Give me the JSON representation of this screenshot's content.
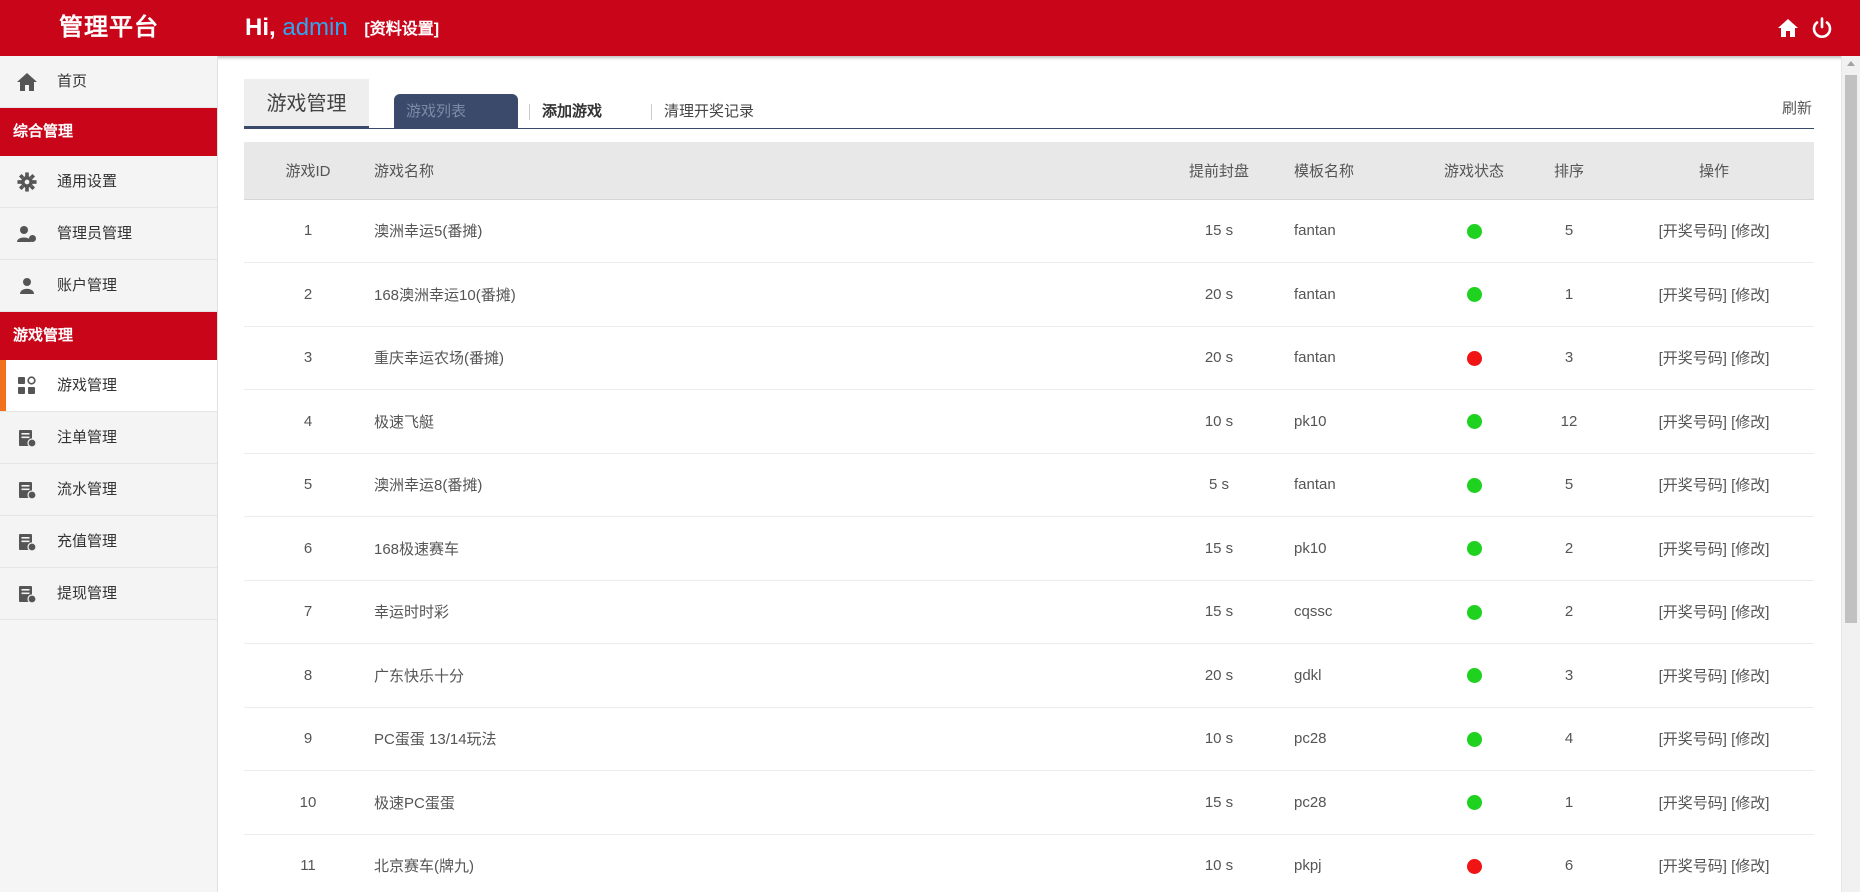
{
  "header": {
    "logo": "管理平台",
    "greeting": "Hi,",
    "username": "admin",
    "profile_link": "[资料设置]",
    "home_icon": "home-icon",
    "power_icon": "power-icon",
    "bg_color": "#c90519"
  },
  "sidebar": {
    "home": {
      "label": "首页",
      "icon": "home-icon"
    },
    "group1": {
      "title": "综合管理"
    },
    "general": {
      "label": "通用设置",
      "icon": "gear-icon"
    },
    "admins": {
      "label": "管理员管理",
      "icon": "admins-icon"
    },
    "accounts": {
      "label": "账户管理",
      "icon": "user-icon"
    },
    "group2": {
      "title": "游戏管理"
    },
    "games": {
      "label": "游戏管理",
      "icon": "apps-icon"
    },
    "bets": {
      "label": "注单管理",
      "icon": "ledger-icon"
    },
    "flows": {
      "label": "流水管理",
      "icon": "ledger-icon"
    },
    "recharge": {
      "label": "充值管理",
      "icon": "ledger-icon"
    },
    "withdraw": {
      "label": "提现管理",
      "icon": "ledger-icon"
    },
    "active_accent": "#f2711c"
  },
  "main": {
    "page_title": "游戏管理",
    "tabs": {
      "list": "游戏列表",
      "add": "添加游戏",
      "clear": "清理开奖记录"
    },
    "refresh": "刷新",
    "columns": {
      "id": "游戏ID",
      "name": "游戏名称",
      "close": "提前封盘",
      "template": "模板名称",
      "status": "游戏状态",
      "sort": "排序",
      "op": "操作"
    },
    "ops": {
      "draw": "[开奖号码]",
      "edit": "[修改]"
    },
    "status_colors": {
      "on": "#1fd21f",
      "off": "#f01414"
    },
    "rows": [
      {
        "id": "1",
        "name": "澳洲幸运5(番摊)",
        "close": "15 s",
        "template": "fantan",
        "status": "on",
        "sort": "5"
      },
      {
        "id": "2",
        "name": "168澳洲幸运10(番摊)",
        "close": "20 s",
        "template": "fantan",
        "status": "on",
        "sort": "1"
      },
      {
        "id": "3",
        "name": "重庆幸运农场(番摊)",
        "close": "20 s",
        "template": "fantan",
        "status": "off",
        "sort": "3"
      },
      {
        "id": "4",
        "name": "极速飞艇",
        "close": "10 s",
        "template": "pk10",
        "status": "on",
        "sort": "12"
      },
      {
        "id": "5",
        "name": "澳洲幸运8(番摊)",
        "close": "5 s",
        "template": "fantan",
        "status": "on",
        "sort": "5"
      },
      {
        "id": "6",
        "name": "168极速赛车",
        "close": "15 s",
        "template": "pk10",
        "status": "on",
        "sort": "2"
      },
      {
        "id": "7",
        "name": "幸运时时彩",
        "close": "15 s",
        "template": "cqssc",
        "status": "on",
        "sort": "2"
      },
      {
        "id": "8",
        "name": "广东快乐十分",
        "close": "20 s",
        "template": "gdkl",
        "status": "on",
        "sort": "3"
      },
      {
        "id": "9",
        "name": "PC蛋蛋 13/14玩法",
        "close": "10 s",
        "template": "pc28",
        "status": "on",
        "sort": "4"
      },
      {
        "id": "10",
        "name": "极速PC蛋蛋",
        "close": "15 s",
        "template": "pc28",
        "status": "on",
        "sort": "1"
      },
      {
        "id": "11",
        "name": "北京赛车(牌九)",
        "close": "10 s",
        "template": "pkpj",
        "status": "off",
        "sort": "6"
      }
    ]
  }
}
